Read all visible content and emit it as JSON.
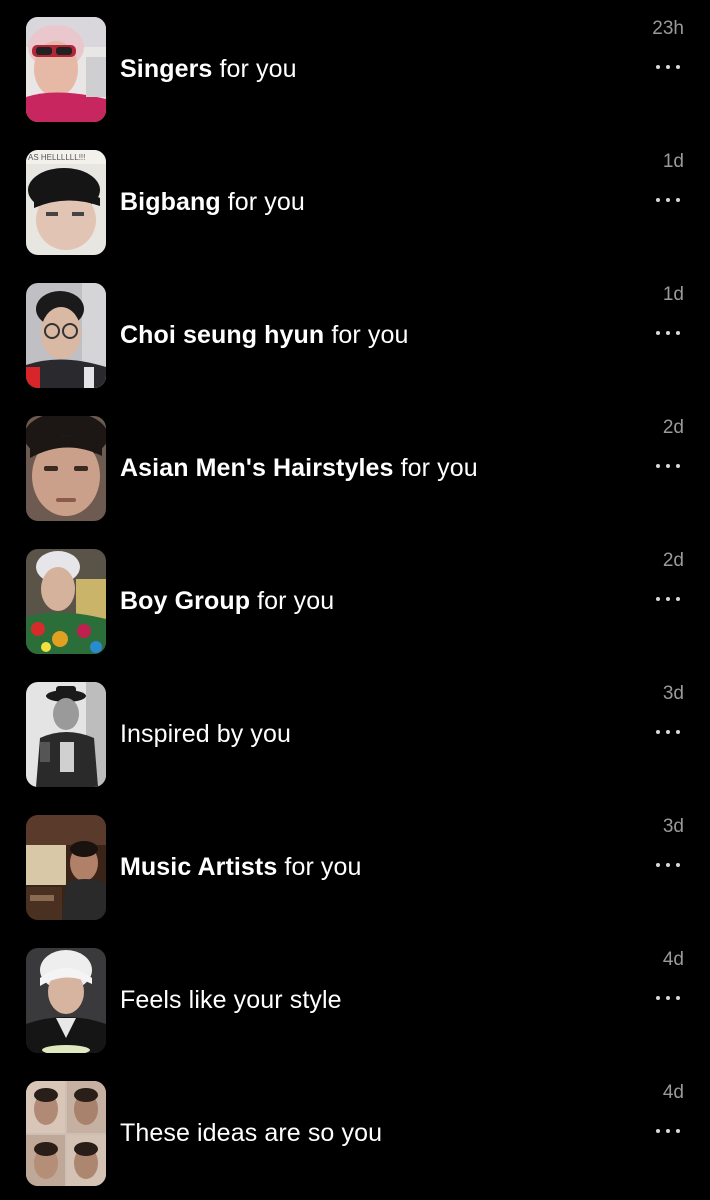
{
  "notifications": [
    {
      "bold": "Singers",
      "rest": " for you",
      "time": "23h",
      "thumb": "selfie-pink-hair-icon"
    },
    {
      "bold": "Bigbang",
      "rest": " for you",
      "time": "1d",
      "thumb": "selfie-black-hair-icon",
      "thumb_text": "AS HELLLLLL!!!"
    },
    {
      "bold": "Choi seung hyun",
      "rest": " for you",
      "time": "1d",
      "thumb": "glasses-portrait-icon"
    },
    {
      "bold": "Asian Men's Hairstyles",
      "rest": " for you",
      "time": "2d",
      "thumb": "closeup-portrait-icon"
    },
    {
      "bold": "Boy Group",
      "rest": " for you",
      "time": "2d",
      "thumb": "floral-shirt-portrait-icon"
    },
    {
      "bold": "",
      "rest": "Inspired by you",
      "time": "3d",
      "thumb": "bw-hat-portrait-icon"
    },
    {
      "bold": "Music Artists",
      "rest": " for you",
      "time": "3d",
      "thumb": "studio-scene-icon"
    },
    {
      "bold": "",
      "rest": "Feels like your style",
      "time": "4d",
      "thumb": "silver-hair-portrait-icon"
    },
    {
      "bold": "",
      "rest": "These ideas are so you",
      "time": "4d",
      "thumb": "photo-collage-icon"
    }
  ],
  "more_icon": "ellipsis-icon",
  "colors": {
    "background": "#000000",
    "text": "#ffffff",
    "time": "#9a9a9a"
  }
}
